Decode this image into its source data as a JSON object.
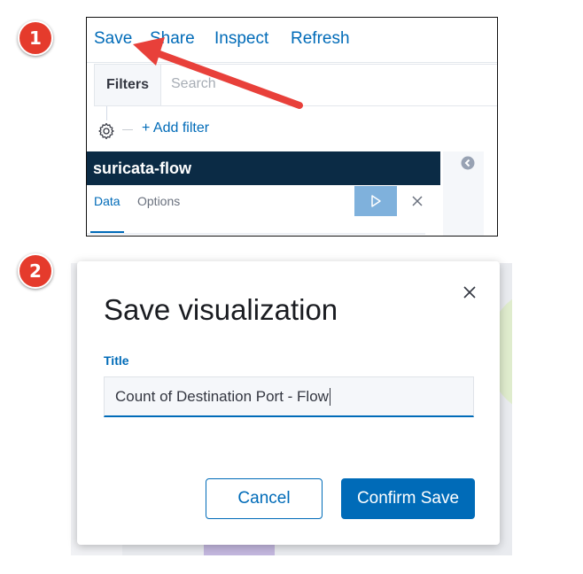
{
  "steps": {
    "one": "1",
    "two": "2"
  },
  "screenshot1": {
    "toolbar": {
      "save": "Save",
      "share": "Share",
      "inspect": "Inspect",
      "refresh": "Refresh"
    },
    "filter_bar": {
      "filters_label": "Filters",
      "search_placeholder": "Search"
    },
    "add_filter": "+ Add filter",
    "index_pattern": "suricata-flow",
    "tabs": {
      "data": "Data",
      "options": "Options"
    },
    "icons": {
      "settings": "gear-icon",
      "collapse": "chevron-left-circle-icon",
      "apply": "play-icon",
      "discard": "close-icon"
    }
  },
  "screenshot2": {
    "modal": {
      "title": "Save visualization",
      "field_label": "Title",
      "field_value": "Count of Destination Port - Flow",
      "cancel_label": "Cancel",
      "confirm_label": "Confirm Save"
    }
  },
  "colors": {
    "badge": "#e53b2c",
    "link": "#006bb8",
    "index_bar": "#0b2b45",
    "arrow": "#e8403a"
  }
}
